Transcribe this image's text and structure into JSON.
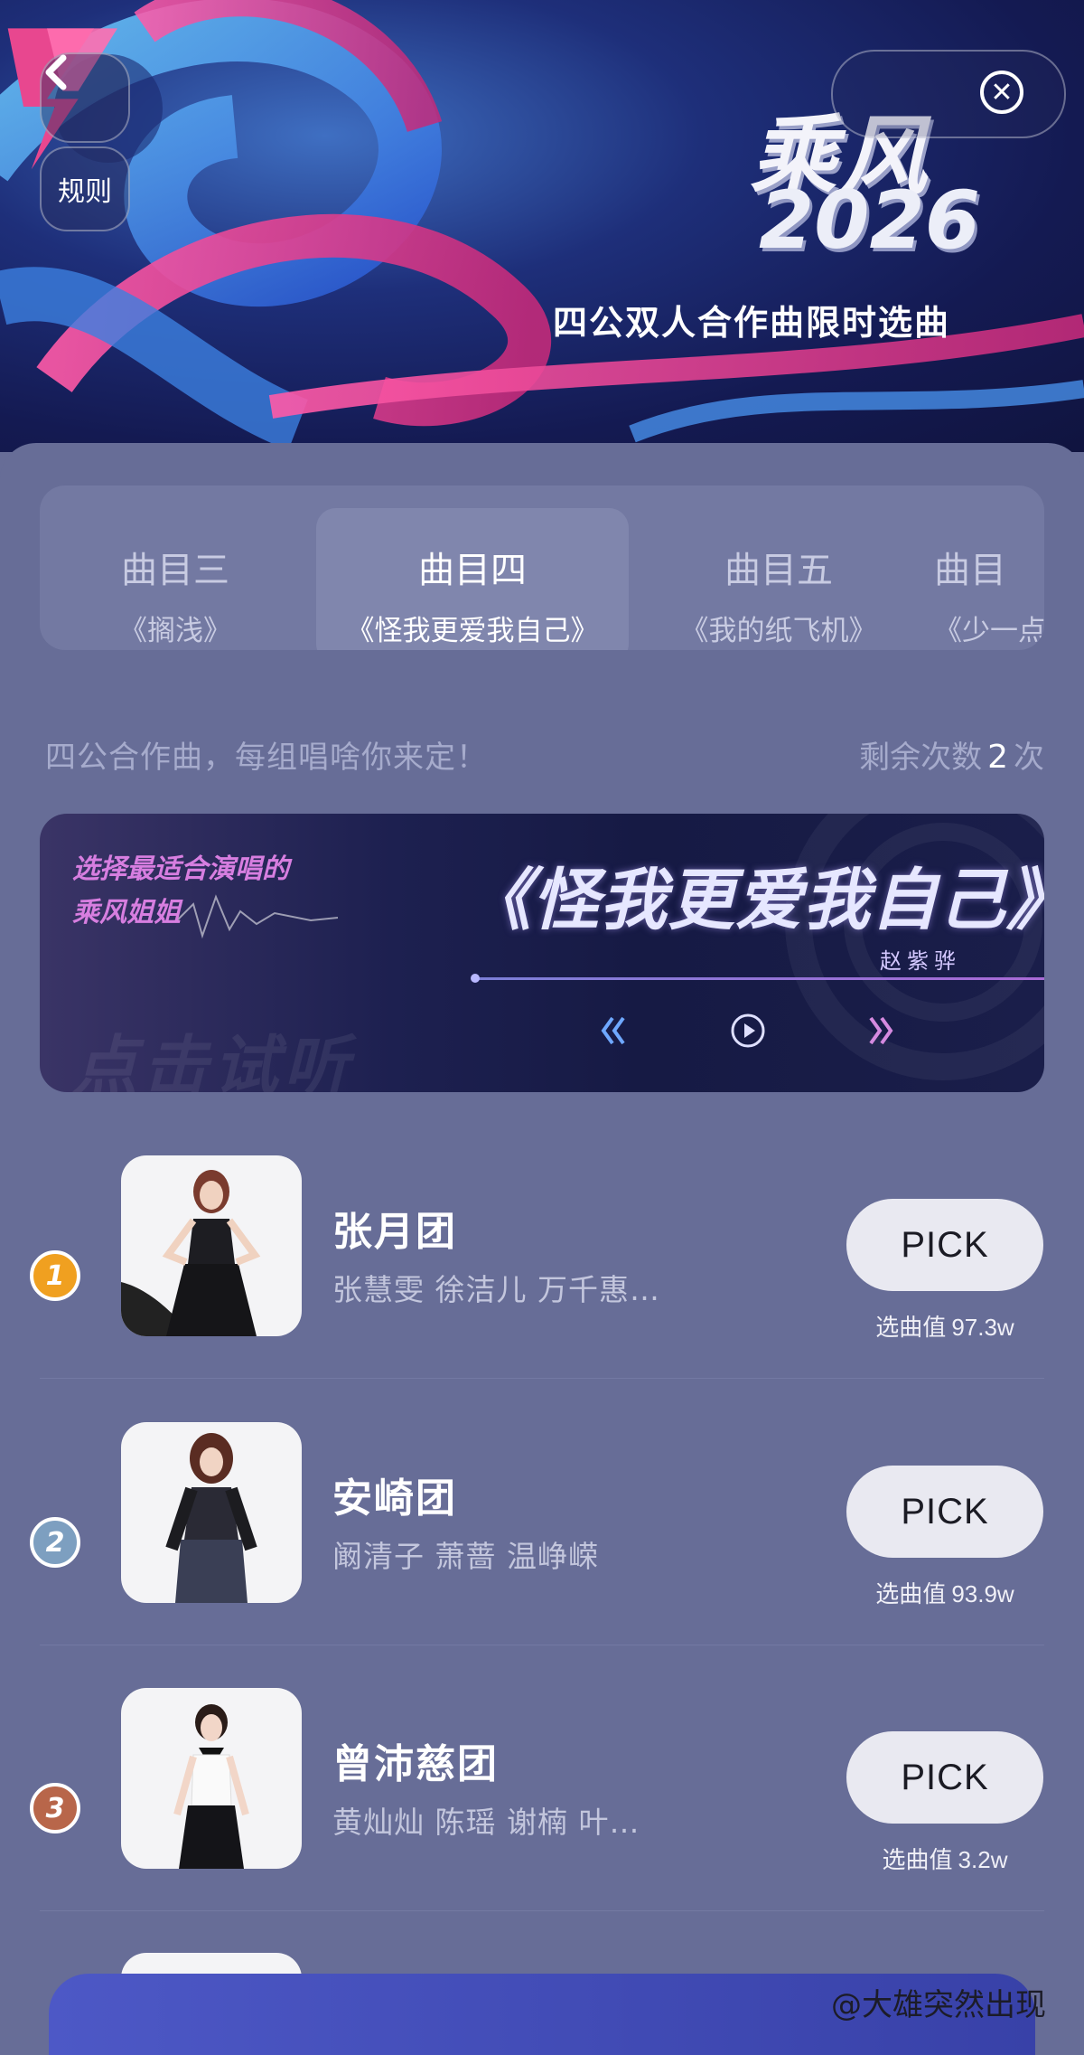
{
  "header": {
    "logo_title": "乘风",
    "logo_year": "2026",
    "subtitle": "四公双人合作曲限时选曲",
    "rules_label": "规则",
    "back_icon": "chevron-left-icon",
    "close_icon": "close-icon"
  },
  "tabs": [
    {
      "label": "曲目三",
      "song": "《搁浅》"
    },
    {
      "label": "曲目四",
      "song": "《怪我更爱我自己》",
      "active": true
    },
    {
      "label": "曲目五",
      "song": "《我的纸飞机》"
    },
    {
      "label": "曲目",
      "song": "《少一点"
    }
  ],
  "info": {
    "tagline": "四公合作曲，每组唱啥你来定！",
    "remaining_prefix": "剩余次数",
    "remaining_count": "2",
    "remaining_suffix": "次"
  },
  "player": {
    "prompt_line1": "选择最适合演唱的",
    "prompt_line2": "乘风姐姐",
    "ghost_text": "点击试听",
    "song_title": "《怪我更爱我自己》",
    "singer": "赵紫骅"
  },
  "teams": [
    {
      "rank": "1",
      "name": "张月团",
      "members": "张慧雯 徐洁儿 万千惠…",
      "pick_label": "PICK",
      "value_label": "选曲值",
      "value": "97.3w",
      "rank_color": "#f0a020"
    },
    {
      "rank": "2",
      "name": "安崎团",
      "members": "阚清子 萧蔷 温峥嵘",
      "pick_label": "PICK",
      "value_label": "选曲值",
      "value": "93.9w",
      "rank_color": "#7d9fc0"
    },
    {
      "rank": "3",
      "name": "曾沛慈团",
      "members": "黄灿灿 陈瑶 谢楠 叶…",
      "pick_label": "PICK",
      "value_label": "选曲值",
      "value": "3.2w",
      "rank_color": "#b8664a"
    }
  ],
  "watermark": "@大雄突然出现",
  "colors": {
    "background": "#676d97",
    "accent_pink": "#e8478f",
    "pick_button": "#e9e9f1"
  }
}
